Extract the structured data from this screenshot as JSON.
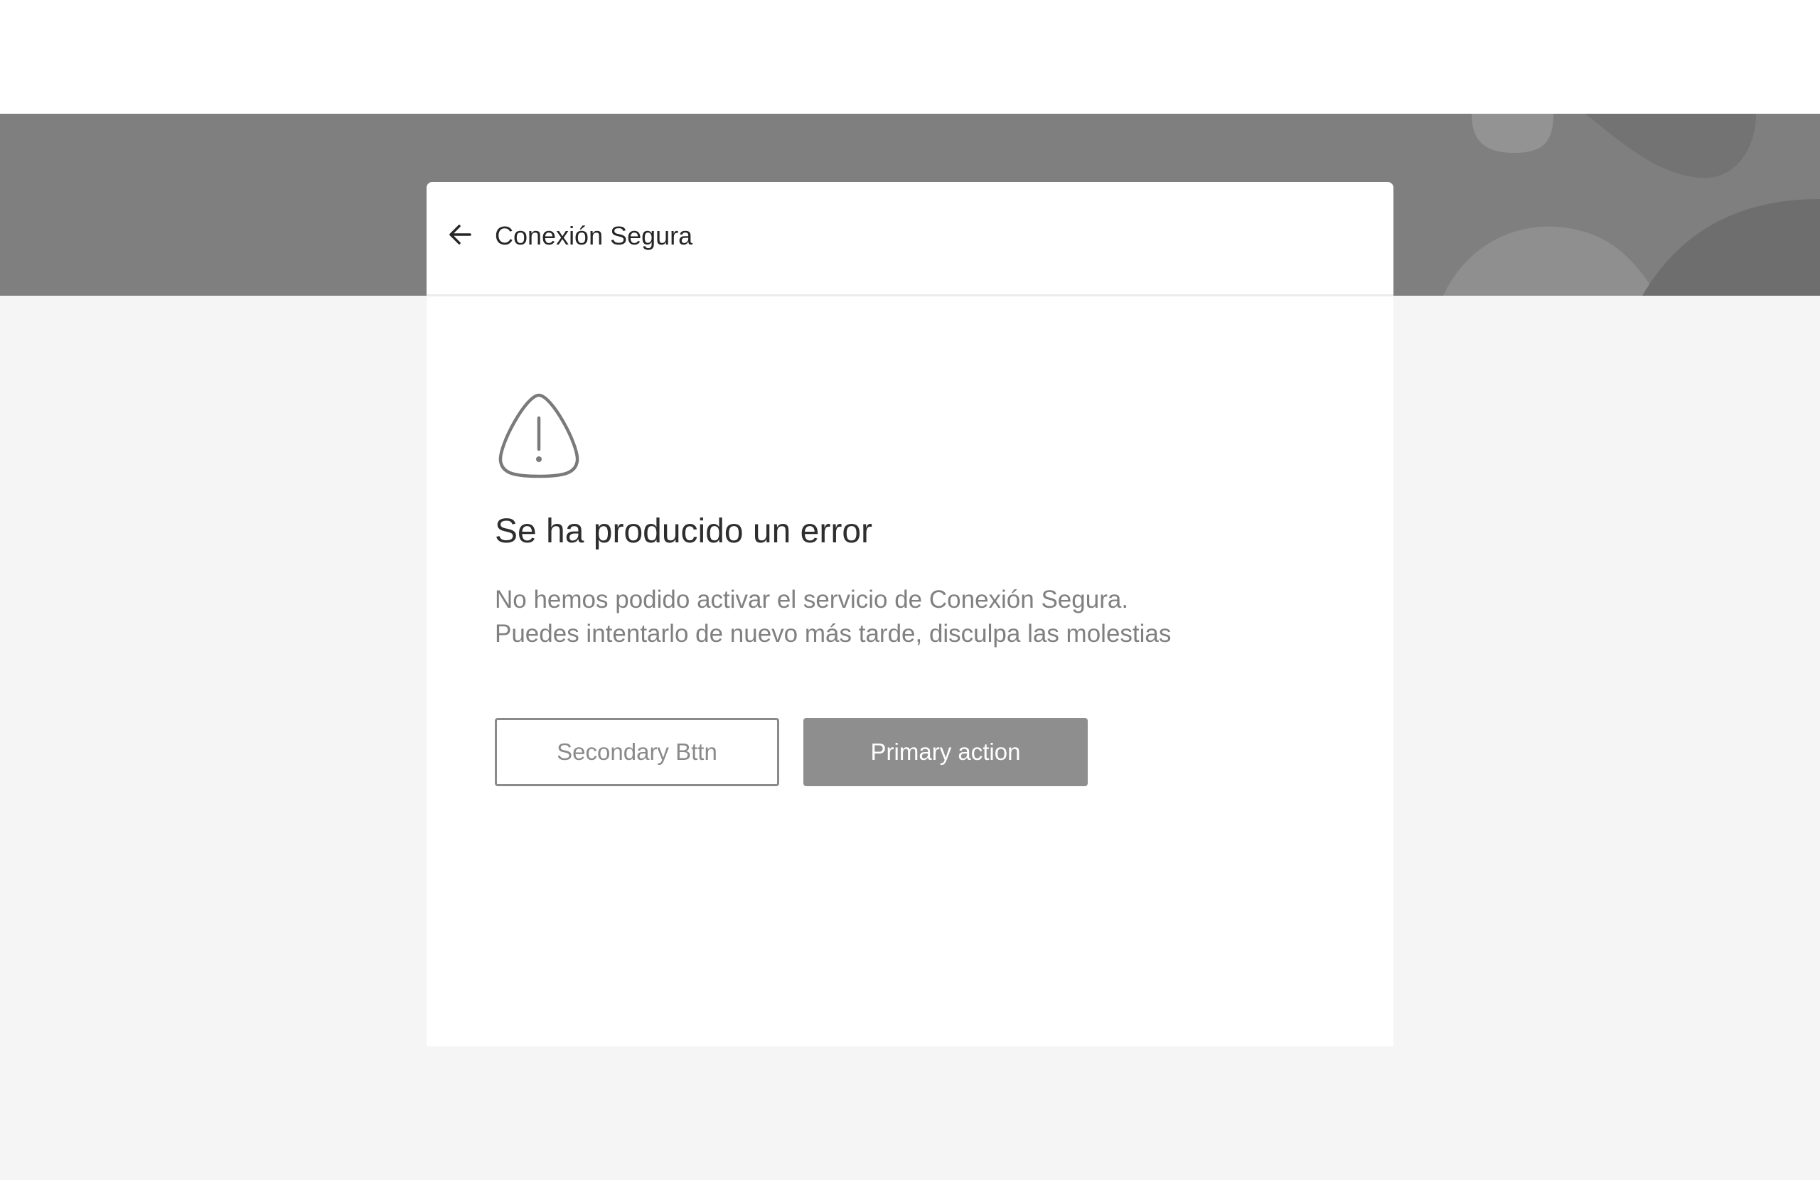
{
  "header": {
    "title": "Conexión Segura",
    "back_icon": "arrow-left-icon"
  },
  "error": {
    "icon": "warning-triangle-icon",
    "title": "Se ha producido un error",
    "message": "No hemos podido activar el servicio de Conexión Segura. Puedes intentarlo de nuevo más tarde, disculpa las molestias"
  },
  "actions": {
    "secondary_label": "Secondary Bttn",
    "primary_label": "Primary action"
  },
  "colors": {
    "band": "#7f7f7f",
    "page_background": "#f5f5f5",
    "primary_button": "#8e8e8e",
    "secondary_border": "#8a8a8a"
  }
}
